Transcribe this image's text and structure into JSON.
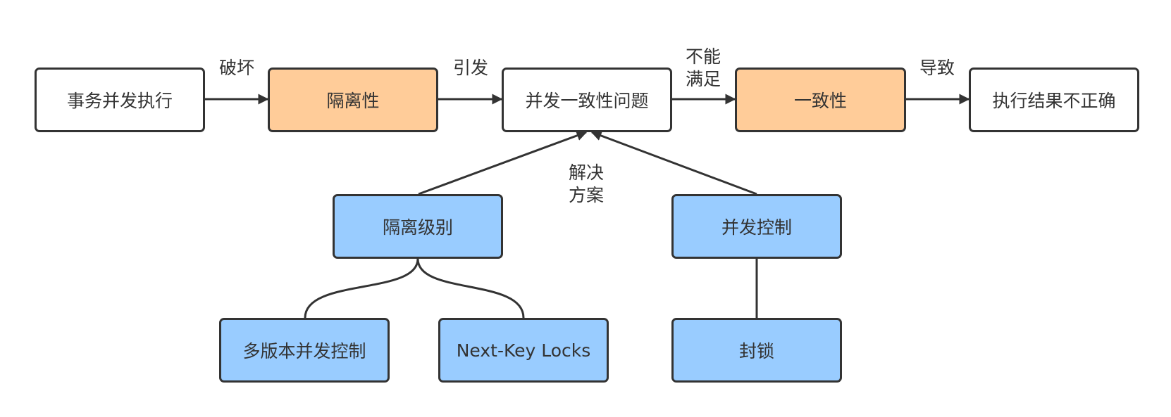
{
  "colors": {
    "white": "#ffffff",
    "orange": "#ffcc99",
    "blue": "#99ccff",
    "border": "#333333"
  },
  "nodes": {
    "transaction_concurrency": "事务并发执行",
    "isolation": "隔离性",
    "concurrency_consistency_problem": "并发一致性问题",
    "consistency": "一致性",
    "incorrect_result": "执行结果不正确",
    "isolation_level": "隔离级别",
    "concurrency_control": "并发控制",
    "mvcc": "多版本并发控制",
    "next_key_locks": "Next-Key Locks",
    "locking": "封锁"
  },
  "edge_labels": {
    "destroy": "破坏",
    "cause": "引发",
    "cannot_satisfy_line1": "不能",
    "cannot_satisfy_line2": "满足",
    "lead_to": "导致",
    "solve_line1": "解决",
    "solve_line2": "方案"
  }
}
